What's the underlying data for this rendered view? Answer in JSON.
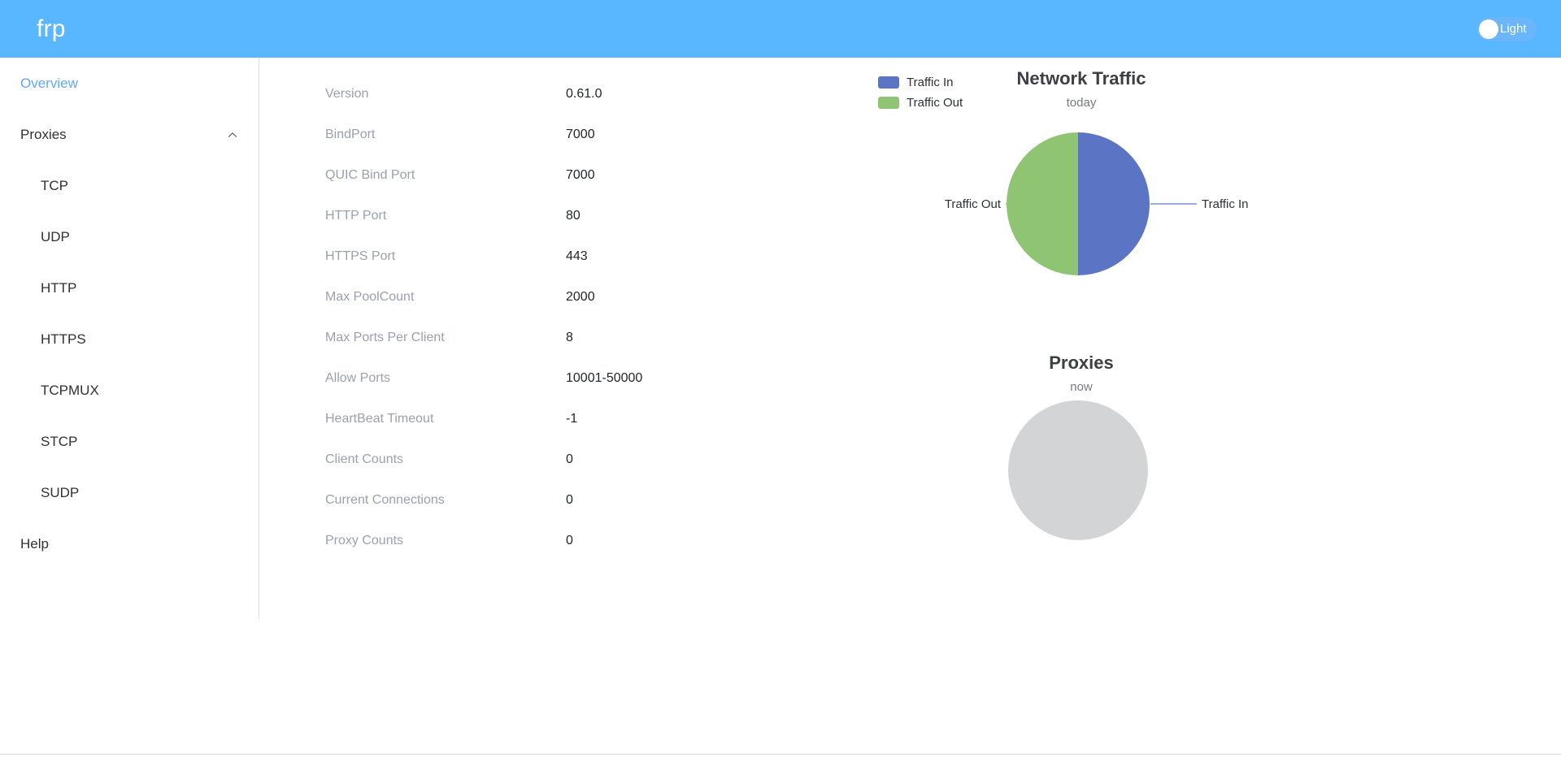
{
  "header": {
    "brand": "frp",
    "theme_toggle_label": "Light",
    "theme_toggle_state": "off",
    "background_color": "#58b7ff"
  },
  "sidebar": {
    "items": [
      {
        "label": "Overview",
        "active": true
      },
      {
        "label": "Proxies",
        "expanded": true,
        "chevron": "chevron-up-icon"
      },
      {
        "label": "TCP"
      },
      {
        "label": "UDP"
      },
      {
        "label": "HTTP"
      },
      {
        "label": "HTTPS"
      },
      {
        "label": "TCPMUX"
      },
      {
        "label": "STCP"
      },
      {
        "label": "SUDP"
      },
      {
        "label": "Help"
      }
    ]
  },
  "server_info": {
    "rows": [
      {
        "label": "Version",
        "value": "0.61.0"
      },
      {
        "label": "BindPort",
        "value": "7000"
      },
      {
        "label": "QUIC Bind Port",
        "value": "7000"
      },
      {
        "label": "HTTP Port",
        "value": "80"
      },
      {
        "label": "HTTPS Port",
        "value": "443"
      },
      {
        "label": "Max PoolCount",
        "value": "2000"
      },
      {
        "label": "Max Ports Per Client",
        "value": "8"
      },
      {
        "label": "Allow Ports",
        "value": "10001-50000"
      },
      {
        "label": "HeartBeat Timeout",
        "value": "-1"
      },
      {
        "label": "Client Counts",
        "value": "0"
      },
      {
        "label": "Current Connections",
        "value": "0"
      },
      {
        "label": "Proxy Counts",
        "value": "0"
      }
    ]
  },
  "chart_data": [
    {
      "type": "pie",
      "title": "Network Traffic",
      "subtitle": "today",
      "labels": [
        "Traffic In",
        "Traffic Out"
      ],
      "values": [
        50,
        50
      ],
      "colors": [
        "#5b75c4",
        "#8fc572"
      ],
      "legend_position": "top-left",
      "slice_labels": [
        "Traffic Out",
        "Traffic In"
      ],
      "legend": [
        {
          "name": "Traffic In",
          "color": "#5b75c4"
        },
        {
          "name": "Traffic Out",
          "color": "#8fc572"
        }
      ]
    },
    {
      "type": "pie",
      "title": "Proxies",
      "subtitle": "now",
      "labels": [],
      "values": [],
      "colors": [
        "#d3d4d5"
      ],
      "empty": true,
      "empty_color": "#d3d4d5"
    }
  ]
}
